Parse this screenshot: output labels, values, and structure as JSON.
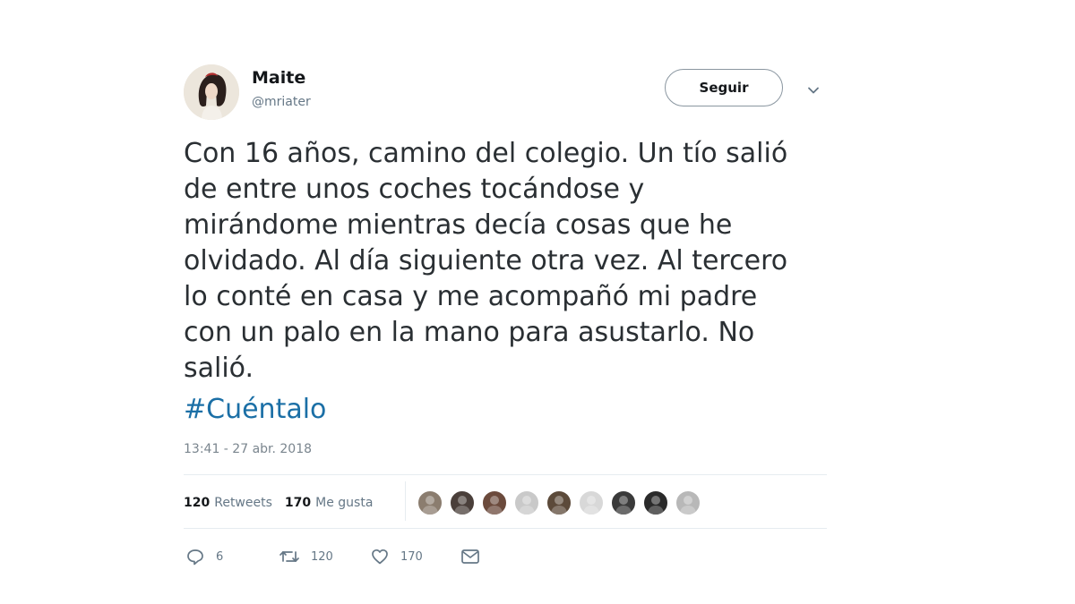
{
  "author": {
    "name": "Maite",
    "handle": "@mriater"
  },
  "follow_button_label": "Seguir",
  "tweet": {
    "text": "Con 16 años, camino del colegio. Un tío salió\nde entre unos coches tocándose y\nmirándome mientras decía cosas que he\nolvidado. Al día siguiente otra vez. Al tercero\nlo conté en casa y me acompañó mi padre\ncon un palo en la mano para asustarlo. No\nsalió.",
    "hashtag": "#Cuéntalo",
    "timestamp": "13:41 - 27 abr. 2018"
  },
  "stats": {
    "retweets_count": "120",
    "retweets_label": "Retweets",
    "likes_count": "170",
    "likes_label": "Me gusta"
  },
  "likers": [
    {
      "color": "#8b7d6f"
    },
    {
      "color": "#4a3f3a"
    },
    {
      "color": "#6b4a3c"
    },
    {
      "color": "#c9c9c9"
    },
    {
      "color": "#5c4a3a"
    },
    {
      "color": "#d8d8d8"
    },
    {
      "color": "#3a3a3a"
    },
    {
      "color": "#2a2a2a"
    },
    {
      "color": "#b8b8b8"
    }
  ],
  "actions": {
    "reply_count": "6",
    "retweet_count": "120",
    "like_count": "170"
  },
  "colors": {
    "link": "#1b6fa6",
    "secondary_text": "#657786",
    "divider": "#e6ecf0"
  }
}
